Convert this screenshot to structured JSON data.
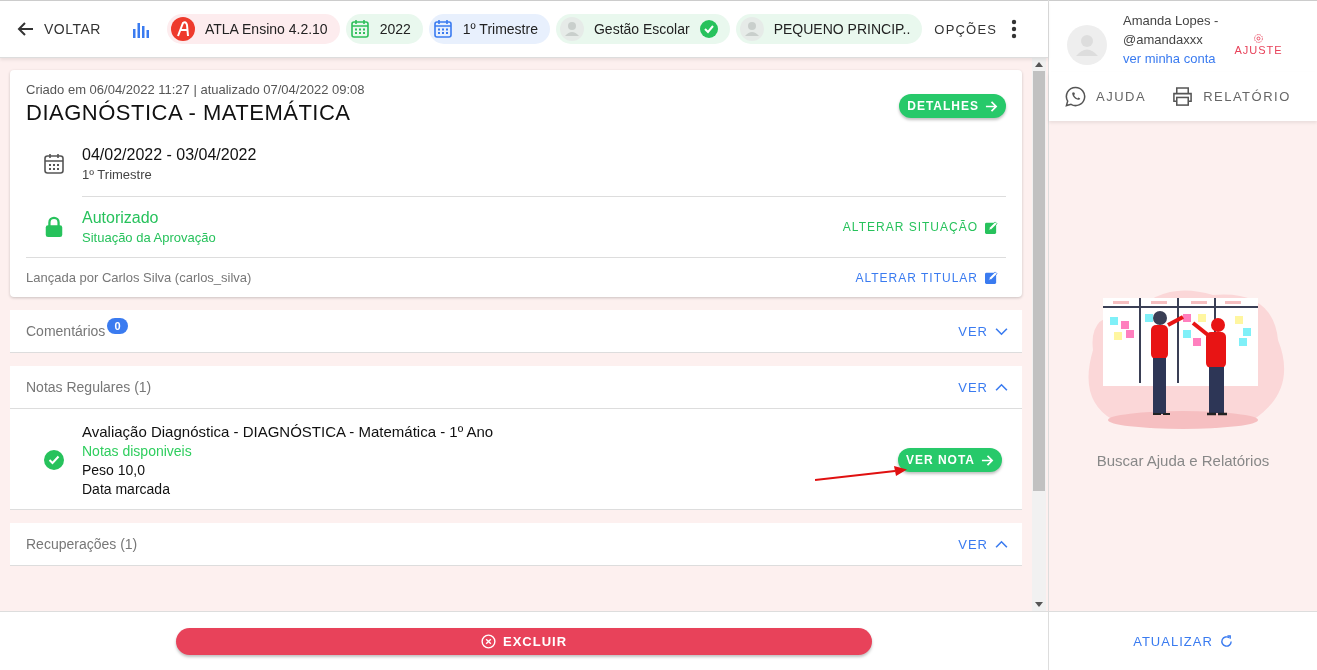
{
  "topbar": {
    "back": "VOLTAR",
    "chips": [
      {
        "kind": "logo",
        "label": "ATLA Ensino 4.2.10",
        "color": "#fdecee",
        "verified": false
      },
      {
        "kind": "calendar",
        "label": "2022",
        "color": "#e9f8ee",
        "verified": false
      },
      {
        "kind": "calendar",
        "label": "1º Trimestre",
        "color": "#e8f0fd",
        "verified": false
      },
      {
        "kind": "avatar",
        "label": "Gestão Escolar",
        "color": "#e9f8ee",
        "verified": true
      },
      {
        "kind": "avatar",
        "label": "PEQUENO PRINCIP..",
        "color": "#e9f8ee",
        "verified": false
      }
    ],
    "options": "OPÇÕES"
  },
  "card": {
    "meta": "Criado em 06/04/2022 11:27 | atualizado 07/04/2022 09:08",
    "title": "DIAGNÓSTICA - MATEMÁTICA",
    "details": "DETALHES",
    "period": {
      "dates": "04/02/2022 - 03/04/2022",
      "term": "1º Trimestre"
    },
    "status": {
      "title": "Autorizado",
      "subtitle": "Situação da Aprovação",
      "action": "ALTERAR SITUAÇÃO"
    },
    "owner": {
      "text": "Lançada por Carlos Silva (carlos_silva)",
      "action": "ALTERAR TITULAR"
    }
  },
  "sections": [
    {
      "title": "Comentários",
      "badge": "0",
      "toggle": "VER",
      "expanded": false
    },
    {
      "title": "Notas Regulares (1)",
      "toggle": "VER",
      "expanded": true,
      "items": [
        {
          "title": "Avaliação Diagnóstica - DIAGNÓSTICA - Matemática - 1º Ano",
          "status": "Notas disponiveis",
          "done": true,
          "weight": "Peso 10,0",
          "date": "Data marcada",
          "button": "VER NOTA"
        }
      ]
    },
    {
      "title": "Recuperações (1)",
      "toggle": "VER",
      "expanded": true
    }
  ],
  "delete": "EXCLUIR",
  "account": {
    "name": "Amanda Lopes -",
    "handle": "@amandaxxx",
    "link": "ver minha conta",
    "settings": "AJUSTE"
  },
  "side_tabs": [
    "AJUDA",
    "RELATÓRIO"
  ],
  "caption": "Buscar Ajuda e Relatórios",
  "refresh": "ATUALIZAR"
}
